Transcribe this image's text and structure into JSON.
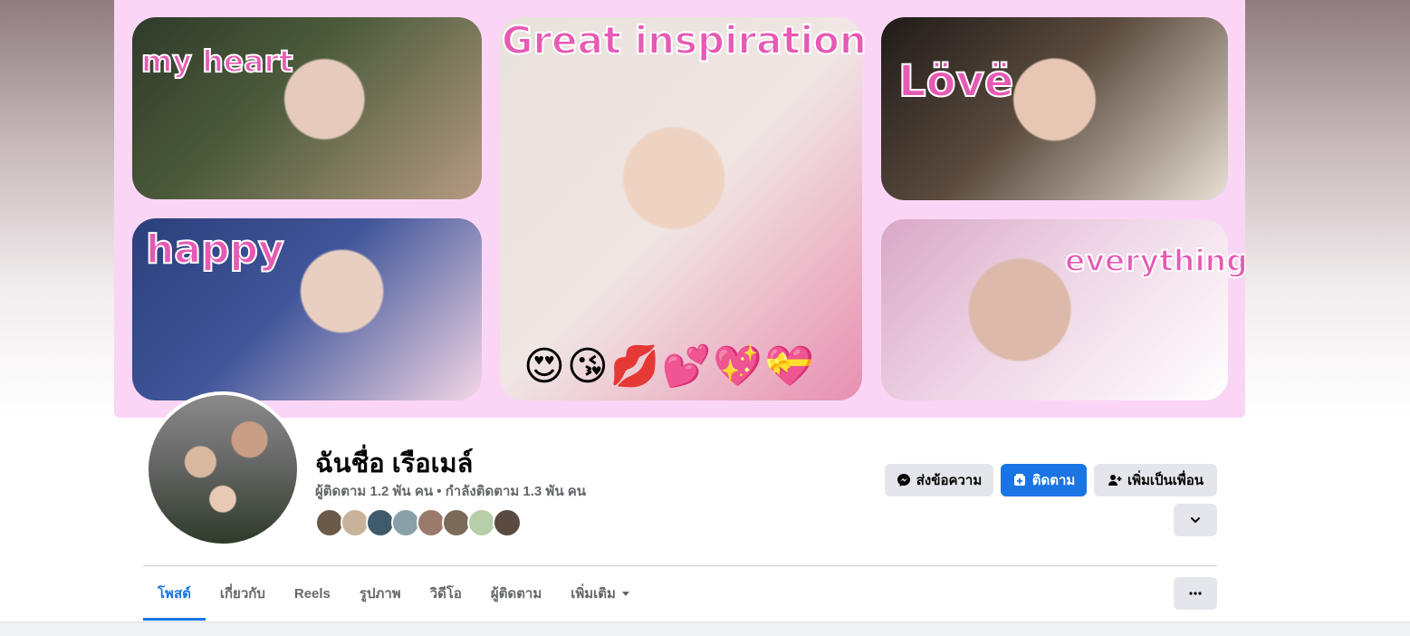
{
  "cover": {
    "texts": [
      "my heart",
      "Great inspiration",
      "Lövë",
      "happy",
      "everything"
    ],
    "emojis": "😍😘💋💕💖💝"
  },
  "profile": {
    "name": "ฉันชื่อ เรือเมล์",
    "stats": "ผู้ติดตาม 1.2 พัน คน • กำลังติดตาม 1.3 พัน คน",
    "friend_avatar_colors": [
      "#6b5a4a",
      "#c8b39a",
      "#3f5a6a",
      "#8aa0a8",
      "#9a7a6a",
      "#7a6a5a",
      "#b7cfa8",
      "#5a4a42"
    ]
  },
  "actions": {
    "message_label": "ส่งข้อความ",
    "follow_label": "ติดตาม",
    "add_friend_label": "เพิ่มเป็นเพื่อน"
  },
  "tabs": [
    {
      "label": "โพสต์"
    },
    {
      "label": "เกี่ยวกับ"
    },
    {
      "label": "Reels"
    },
    {
      "label": "รูปภาพ"
    },
    {
      "label": "วิดีโอ"
    },
    {
      "label": "ผู้ติดตาม"
    },
    {
      "label": "เพิ่มเติม"
    }
  ],
  "colors": {
    "accent": "#1b74e4",
    "cover_bg": "#fbd5f6",
    "cover_text": "#e65ab4"
  }
}
